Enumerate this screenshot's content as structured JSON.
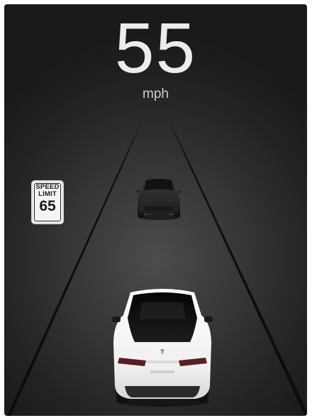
{
  "speed": {
    "value": "55",
    "unit": "mph"
  },
  "speed_limit_sign": {
    "line1": "SPEED",
    "line2": "LIMIT",
    "limit": "65"
  },
  "colors": {
    "background_dark": "#1a1a1b",
    "lane_line": "#0f0f10",
    "lead_vehicle": "#2a2a2c",
    "ego_vehicle": "#f2f2f2"
  },
  "icons": {
    "lead_vehicle": "lead-car-icon",
    "ego_vehicle": "ego-car-icon"
  }
}
